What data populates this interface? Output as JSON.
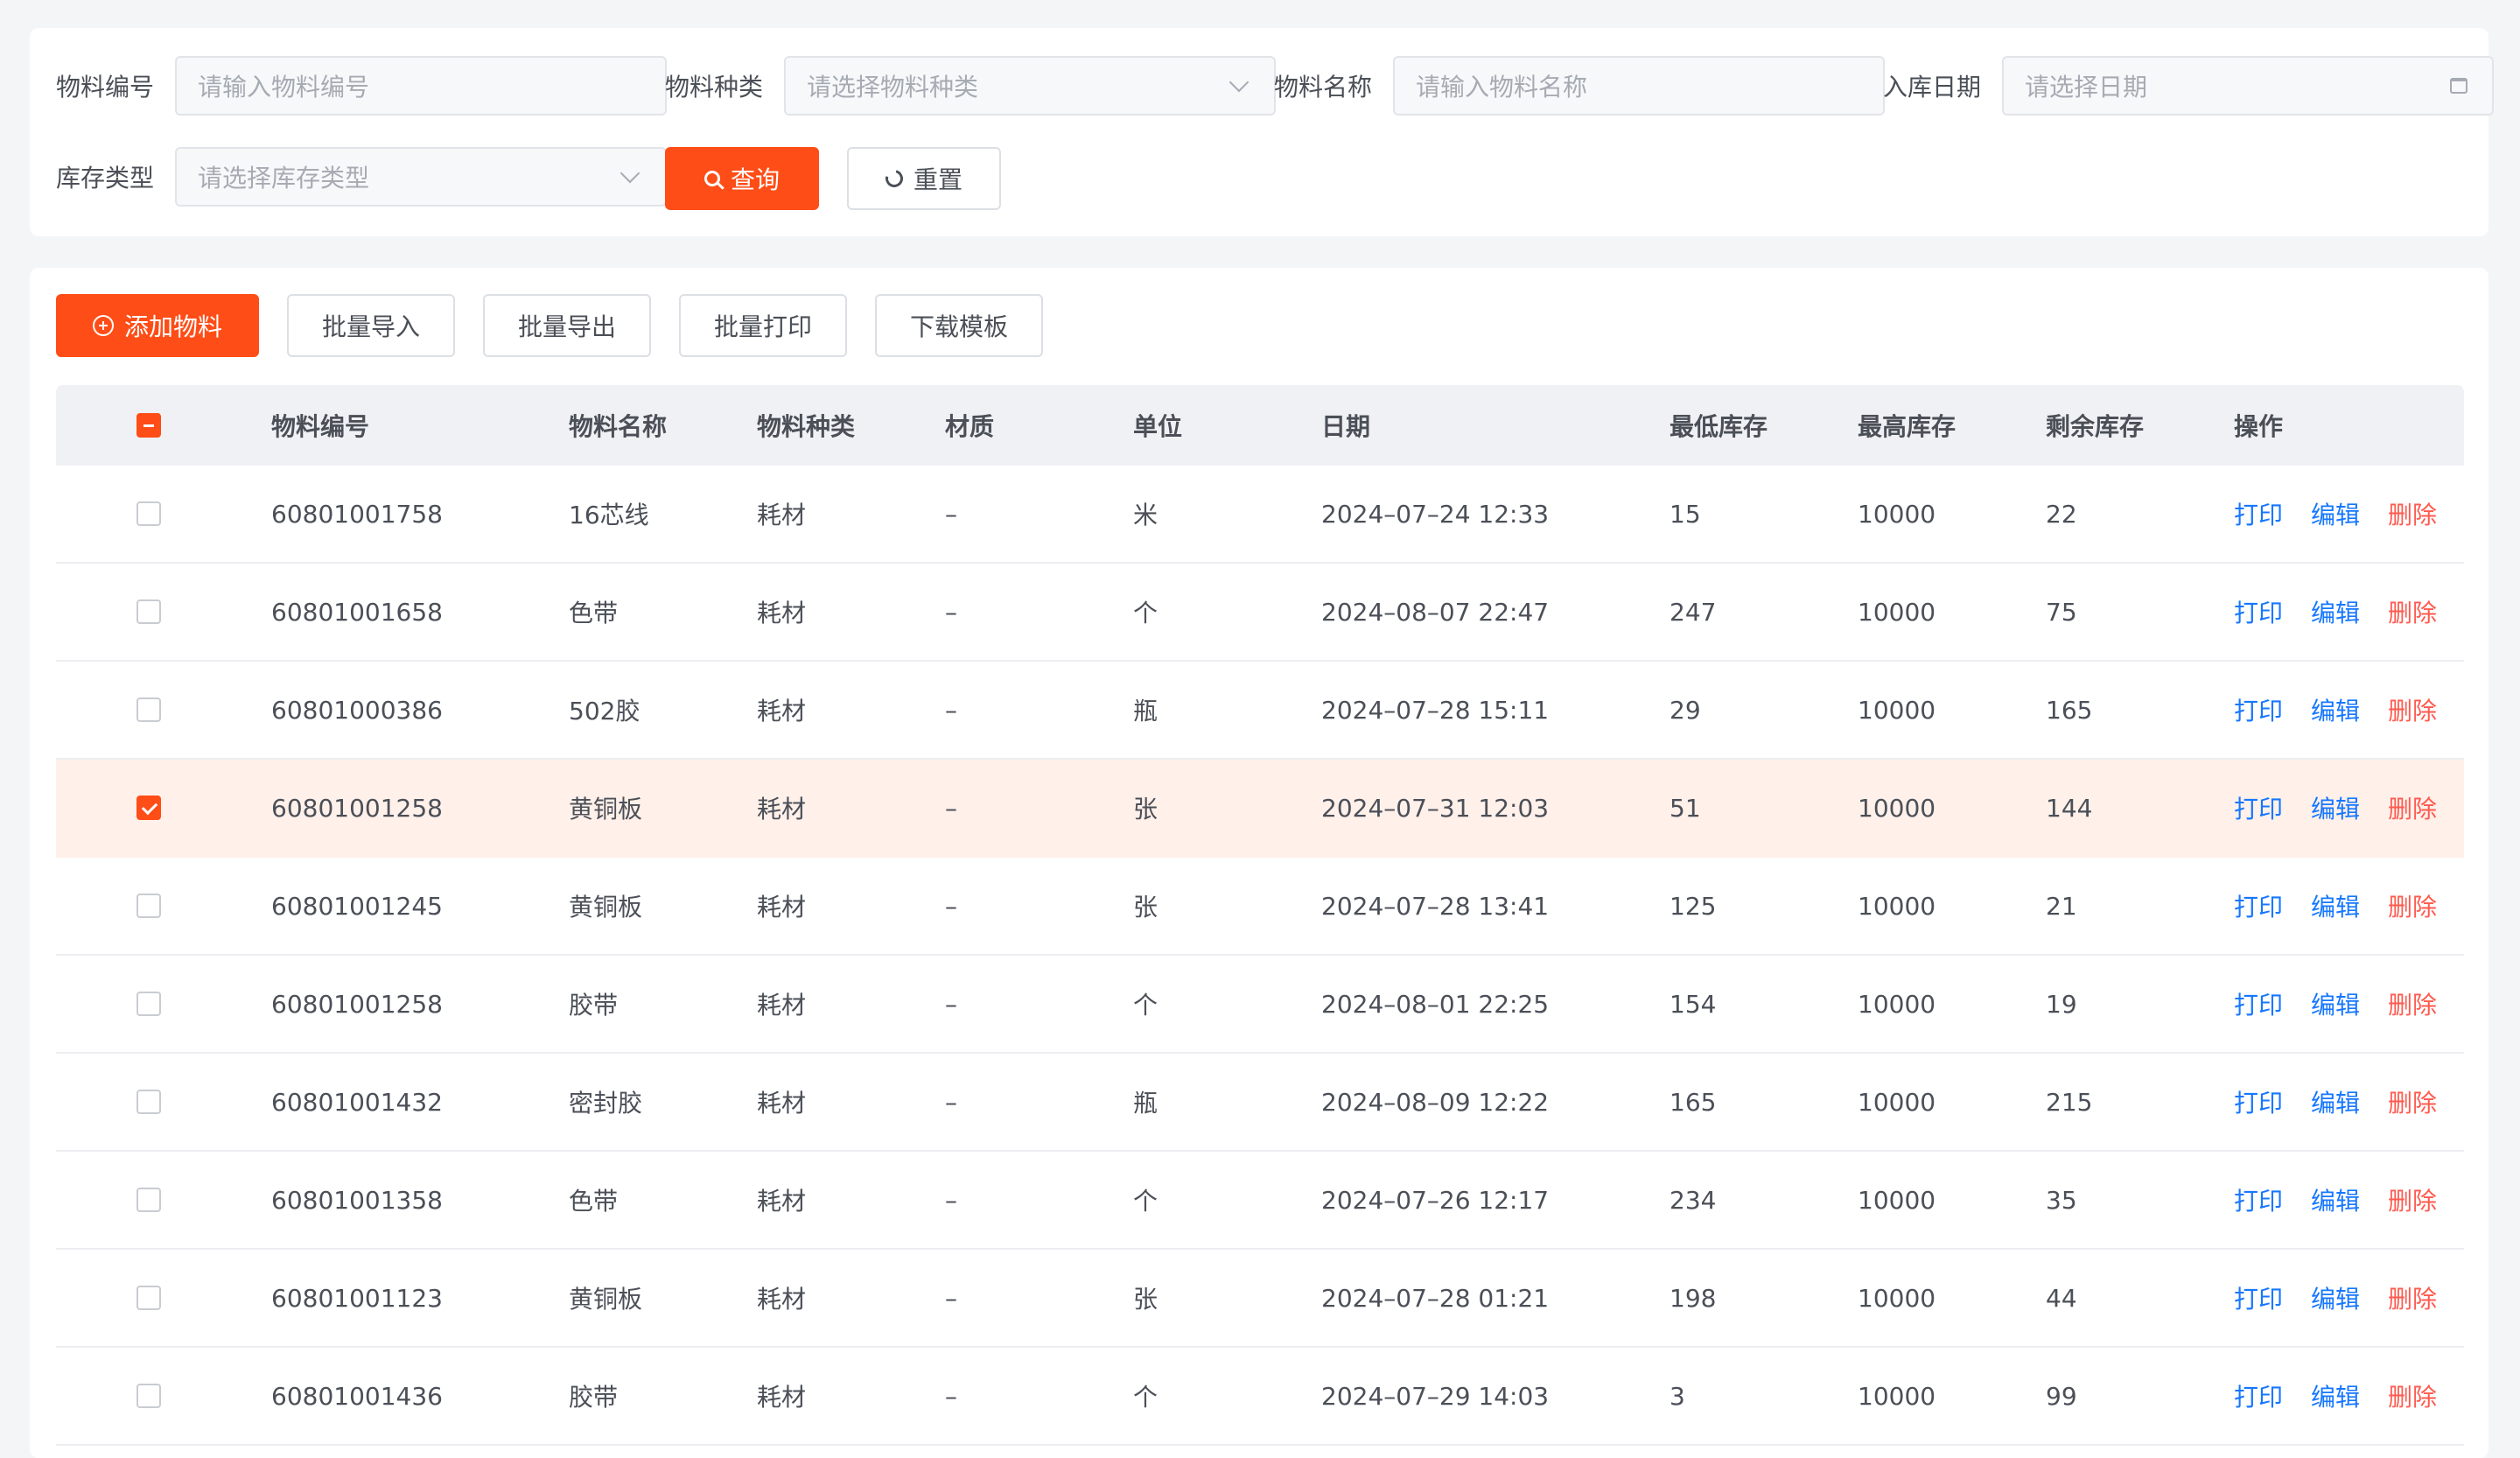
{
  "search": {
    "code_label": "物料编号",
    "code_placeholder": "请输入物料编号",
    "type_label": "物料种类",
    "type_placeholder": "请选择物料种类",
    "name_label": "物料名称",
    "name_placeholder": "请输入物料名称",
    "date_label": "入库日期",
    "date_placeholder": "请选择日期",
    "stock_type_label": "库存类型",
    "stock_type_placeholder": "请选择库存类型",
    "query_label": "查询",
    "reset_label": "重置"
  },
  "toolbar": {
    "add_label": "添加物料",
    "import_label": "批量导入",
    "export_label": "批量导出",
    "print_label": "批量打印",
    "template_label": "下载模板"
  },
  "table": {
    "columns": [
      "物料编号",
      "物料名称",
      "物料种类",
      "材质",
      "单位",
      "日期",
      "最低库存",
      "最高库存",
      "剩余库存",
      "操作"
    ],
    "actions": {
      "print": "打印",
      "edit": "编辑",
      "delete": "删除"
    },
    "rows": [
      {
        "code": "60801001758",
        "name": "16芯线",
        "type": "耗材",
        "material": "–",
        "unit": "米",
        "date": "2024–07–24 12:33",
        "min": "15",
        "max": "10000",
        "remain": "22",
        "checked": false
      },
      {
        "code": "60801001658",
        "name": "色带",
        "type": "耗材",
        "material": "–",
        "unit": "个",
        "date": "2024–08–07 22:47",
        "min": "247",
        "max": "10000",
        "remain": "75",
        "checked": false
      },
      {
        "code": "60801000386",
        "name": "502胶",
        "type": "耗材",
        "material": "–",
        "unit": "瓶",
        "date": "2024–07–28 15:11",
        "min": "29",
        "max": "10000",
        "remain": "165",
        "checked": false
      },
      {
        "code": "60801001258",
        "name": "黄铜板",
        "type": "耗材",
        "material": "–",
        "unit": "张",
        "date": "2024–07–31 12:03",
        "min": "51",
        "max": "10000",
        "remain": "144",
        "checked": true
      },
      {
        "code": "60801001245",
        "name": "黄铜板",
        "type": "耗材",
        "material": "–",
        "unit": "张",
        "date": "2024–07–28 13:41",
        "min": "125",
        "max": "10000",
        "remain": "21",
        "checked": false
      },
      {
        "code": "60801001258",
        "name": "胶带",
        "type": "耗材",
        "material": "–",
        "unit": "个",
        "date": "2024–08–01 22:25",
        "min": "154",
        "max": "10000",
        "remain": "19",
        "checked": false
      },
      {
        "code": "60801001432",
        "name": "密封胶",
        "type": "耗材",
        "material": "–",
        "unit": "瓶",
        "date": "2024–08–09 12:22",
        "min": "165",
        "max": "10000",
        "remain": "215",
        "checked": false
      },
      {
        "code": "60801001358",
        "name": "色带",
        "type": "耗材",
        "material": "–",
        "unit": "个",
        "date": "2024–07–26 12:17",
        "min": "234",
        "max": "10000",
        "remain": "35",
        "checked": false
      },
      {
        "code": "60801001123",
        "name": "黄铜板",
        "type": "耗材",
        "material": "–",
        "unit": "张",
        "date": "2024–07–28 01:21",
        "min": "198",
        "max": "10000",
        "remain": "44",
        "checked": false
      },
      {
        "code": "60801001436",
        "name": "胶带",
        "type": "耗材",
        "material": "–",
        "unit": "个",
        "date": "2024–07–29 14:03",
        "min": "3",
        "max": "10000",
        "remain": "99",
        "checked": false
      }
    ]
  }
}
